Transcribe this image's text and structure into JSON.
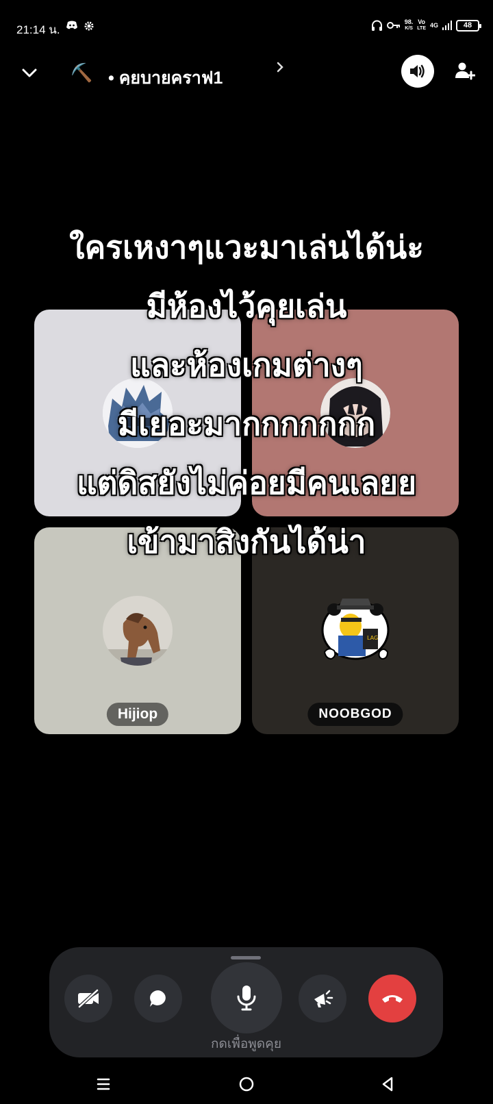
{
  "status_bar": {
    "time": "21:14 น.",
    "net_speed": "98.",
    "net_unit": "K/S",
    "volte": "Vo",
    "lte": "LTE",
    "signal_label": "4G",
    "battery": "48"
  },
  "header": {
    "channel_emoji": "⛏️",
    "channel_name": "• คุยบายคราฟ1"
  },
  "overlay_text": [
    "ใครเหงาๆแวะมาเล่นได้น่ะ",
    "มีห้องไว้คุยเล่น",
    "และห้องเกมต่างๆ",
    "มีเยอะมากกกกกกก",
    "แต่ดิสยังไม่ค่อยมีคนเลยย",
    "เข้ามาสิงกันได้น่า"
  ],
  "participants": [
    {
      "name": "",
      "tile_color": "#dcdbe0"
    },
    {
      "name": "",
      "tile_color": "#b27772"
    },
    {
      "name": "Hijiop",
      "tile_color": "#c7c7be"
    },
    {
      "name": "NOOBGOD",
      "tile_color": "#2b2824"
    }
  ],
  "controls": {
    "camera_icon": "camera-off-icon",
    "chat_icon": "chat-bubble-icon",
    "mic_icon": "microphone-icon",
    "activity_icon": "activity-icon",
    "hangup_icon": "hang-up-icon",
    "push_to_talk_label": "กดเพื่อพูดคุย",
    "hangup_color": "#e34040"
  },
  "navigation": {
    "menu_icon": "recent-apps-icon",
    "home_icon": "home-icon",
    "back_icon": "back-icon"
  }
}
